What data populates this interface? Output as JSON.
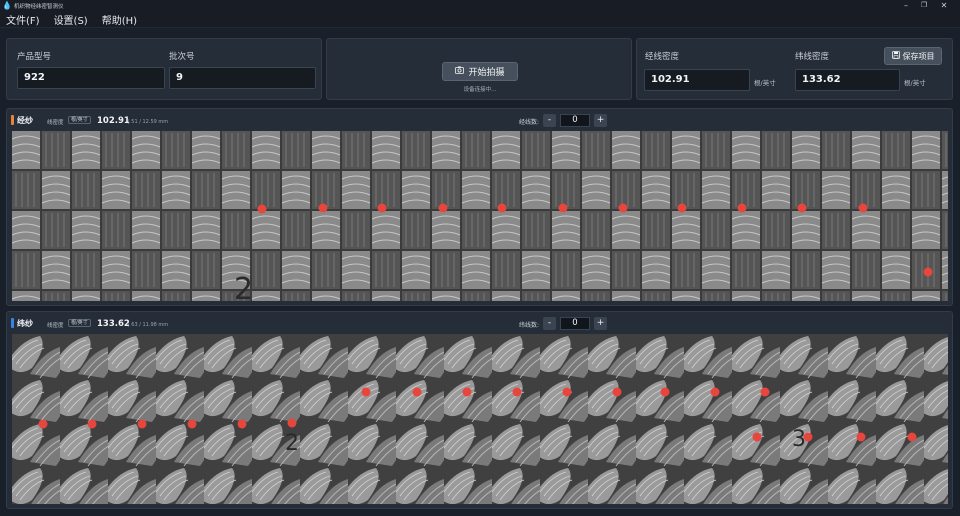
{
  "app": {
    "title": "机织物经纬密智测仪",
    "icon": "water-drop-icon"
  },
  "window_controls": [
    "minimize-icon",
    "restore-icon",
    "close-icon"
  ],
  "menu": [
    {
      "label": "文件(F)"
    },
    {
      "label": "设置(S)"
    },
    {
      "label": "帮助(H)"
    }
  ],
  "product": {
    "model_label": "产品型号",
    "model_value": "922",
    "batch_label": "批次号",
    "batch_value": "9"
  },
  "capture": {
    "button_label": "开始拍摄",
    "status": "设备连接中..."
  },
  "density": {
    "warp_label": "经线密度",
    "warp_value": "102.91",
    "warp_unit": "根/英寸",
    "weft_label": "纬线密度",
    "weft_value": "133.62",
    "weft_unit": "根/英寸"
  },
  "save_button": {
    "label": "保存项目"
  },
  "panels": {
    "warp": {
      "title": "经纱",
      "accent": "#e8833a",
      "density_label": "线密度",
      "unit_badge": "根/英寸",
      "value": "102.91",
      "sub": "| 51 / 12.59 mm",
      "count_label": "经线数:",
      "count": "0",
      "annotation": "2"
    },
    "weft": {
      "title": "纬纱",
      "accent": "#3b82e6",
      "density_label": "线密度",
      "unit_badge": "根/英寸",
      "value": "133.62",
      "sub": "| 63 / 11.98 mm",
      "count_label": "纬线数:",
      "count": "0",
      "annotation_a": "2",
      "annotation_b": "3"
    }
  },
  "colors": {
    "marker": "#e8453c",
    "guide_line": "#4fb0a8",
    "background": "#1a2029",
    "card": "#252d38"
  }
}
